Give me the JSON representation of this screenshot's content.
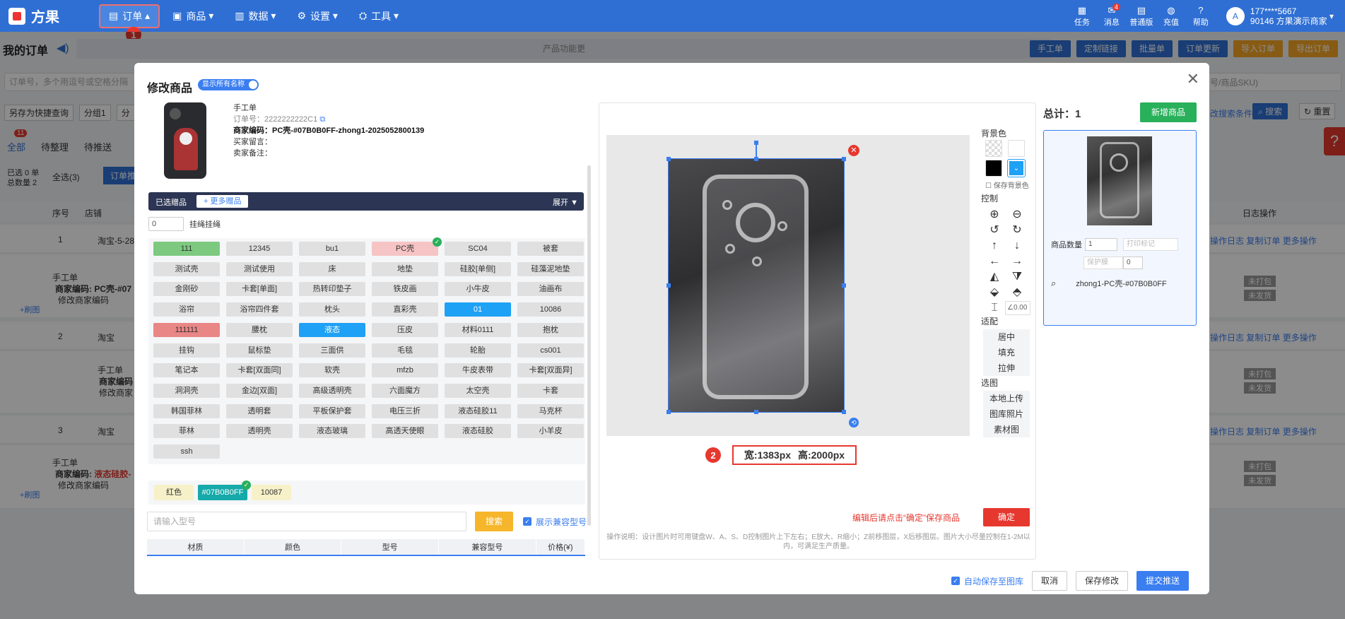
{
  "app": {
    "name": "方果"
  },
  "nav": [
    {
      "label": "订单",
      "icon": "order-icon",
      "active": true
    },
    {
      "label": "商品",
      "icon": "goods-icon"
    },
    {
      "label": "数据",
      "icon": "data-icon"
    },
    {
      "label": "设置",
      "icon": "gear-icon"
    },
    {
      "label": "工具",
      "icon": "tool-icon"
    }
  ],
  "topright": {
    "items": [
      "任务",
      "消息",
      "普通版",
      "充值",
      "帮助"
    ],
    "msg_count": "4",
    "user_phone": "177****5667",
    "user_name": "90146 方果演示商家"
  },
  "annotations": {
    "one": "1",
    "two": "2"
  },
  "background": {
    "title": "我的订单",
    "notice": "产品功能更",
    "buttons": [
      "手工单",
      "定制链接",
      "批量单",
      "订单更新"
    ],
    "buttons_orange": [
      "导入订单",
      "导出订单"
    ],
    "search_placeholder": "订单号，多个用逗号或空格分隔",
    "search_right": "号/商品SKU)",
    "query_btns": [
      "另存为快捷查询",
      "分组1",
      "分"
    ],
    "tabs": [
      "全部",
      "待整理",
      "待推送"
    ],
    "tab_count": "11",
    "select_info": {
      "sel": "已选 0 单",
      "total": "总数量 2"
    },
    "select_all": "全选(3)",
    "push_btn": "订单推",
    "search_btn": "搜索",
    "reset_btn": "重置",
    "more_cond": "改搜索条件",
    "cols": {
      "no": "序号",
      "shop": "店铺",
      "log": "日志操作"
    },
    "rows": [
      {
        "no": "1",
        "shop": "淘宝-5-28"
      },
      {
        "no": "2",
        "shop": "淘宝"
      },
      {
        "no": "3",
        "shop": "淘宝"
      }
    ],
    "rowlinks": [
      "操作日志",
      "复制订单",
      "更多操作"
    ],
    "status": [
      "未打包",
      "未发货"
    ],
    "manual": "手工单",
    "merchant_code": "商家编码:",
    "merchant_code_val": "PC壳-#07",
    "merchant_code_red": "液态硅胶-",
    "merchant_code_short": "商家编码",
    "edit_code": "修改商家编码",
    "edit_code_short": "修改商家",
    "refresh": "+刷图"
  },
  "modal": {
    "title": "修改商品",
    "toggle_label": "显示所有名称",
    "product": {
      "type": "手工单",
      "order_no": "订单号：2222222222C1",
      "merchant_code_label": "商家编码：",
      "merchant_code": "PC壳-#07B0B0FF-zhong1-2025052800139",
      "buyer_note": "买家留言：",
      "seller_note": "卖家备注："
    },
    "selected_bar": {
      "label": "已选赠品",
      "more": "+ 更多赠品",
      "expand": "展开"
    },
    "hang": {
      "value": "0",
      "label": "挂绳挂绳"
    },
    "tags": [
      [
        "111",
        "12345",
        "bu1",
        "PC壳",
        "SC04",
        "被套"
      ],
      [
        "测试壳",
        "测试使用",
        "床",
        "地垫",
        "硅胶[单侧]",
        "硅藻泥地垫"
      ],
      [
        "金刚砂",
        "卡套[单面]",
        "热转印垫子",
        "铁皮画",
        "小牛皮",
        "油画布"
      ],
      [
        "浴帘",
        "浴帘四件套",
        "枕头",
        "直彩壳",
        "01",
        "10086"
      ],
      [
        "111111",
        "腰枕",
        "液态",
        "压皮",
        "材料0111",
        "抱枕"
      ],
      [
        "挂钩",
        "鼠标垫",
        "三面供",
        "毛毯",
        "轮胎",
        "cs001"
      ],
      [
        "笔记本",
        "卡套[双面同]",
        "软壳",
        "mfzb",
        "牛皮表带",
        "卡套[双面异]"
      ],
      [
        "洞洞壳",
        "金边[双面]",
        "高级透明壳",
        "六面魔方",
        "太空壳",
        "卡套"
      ],
      [
        "韩国菲林",
        "透明套",
        "平板保护套",
        "电压三折",
        "液态硅胶11",
        "马克杯"
      ],
      [
        "菲林",
        "透明壳",
        "液态玻璃",
        "高透天使眼",
        "液态硅胶",
        "小羊皮"
      ],
      [
        "ssh"
      ]
    ],
    "colors": [
      "红色",
      "#07B0B0FF",
      "10087"
    ],
    "search": {
      "placeholder": "请输入型号",
      "btn": "搜索",
      "compat": "展示兼容型号"
    },
    "table_cols": [
      "材质",
      "颜色",
      "型号",
      "兼容型号",
      "价格(¥)"
    ],
    "editor": {
      "dims": "宽:1383px 高:2000px",
      "bg_label": "背景色",
      "keep_bg": "保存背景色",
      "control_label": "控制",
      "angle": "∠0.00",
      "fit_label": "适配",
      "fit": [
        "居中",
        "填充",
        "拉伸"
      ],
      "pick_label": "选图",
      "pick": [
        "本地上传",
        "图库照片",
        "素材图"
      ],
      "hint": "编辑后请点击“确定”保存商品",
      "ok": "确定",
      "help": "操作说明：设计图片时可用键盘W、A、S、D控制图片上下左右；E放大、R缩小；Z前移图层，X后移图层。图片大小尽量控制在1-2M以内，可满足生产质量。"
    },
    "right": {
      "total": "总计：1",
      "add": "新增商品",
      "qty_label": "商品数量",
      "qty": "1",
      "print_mark": "打印标记",
      "protect": "保护膜",
      "protect_val": "0",
      "product_name": "zhong1-PC壳-#07B0B0FF"
    },
    "footer": {
      "autosave": "自动保存至图库",
      "cancel": "取消",
      "save": "保存修改",
      "submit": "提交推送"
    }
  },
  "colors": {
    "primary": "#2f6fd4",
    "accent_blue": "#3a7ef0",
    "green": "#29b05b",
    "red": "#e6382f",
    "orange": "#f6b62b"
  }
}
